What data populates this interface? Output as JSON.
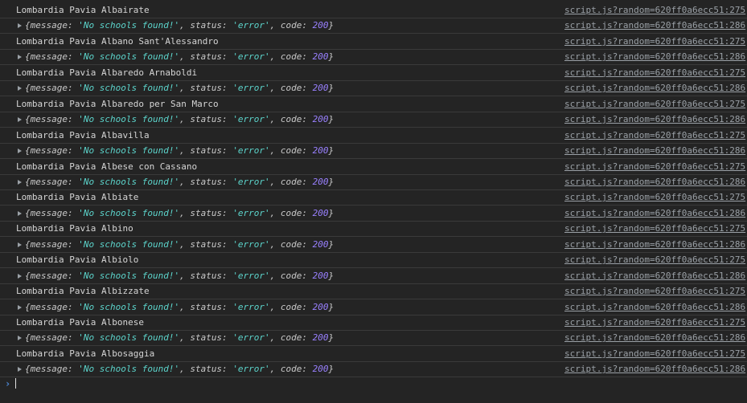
{
  "console": {
    "entries": [
      {
        "type": "text",
        "text": "Lombardia Pavia Albairate",
        "source": "script.js?random=620ff0a6ecc51:275"
      },
      {
        "type": "object",
        "message": "'No schools found!'",
        "status": "'error'",
        "code": "200",
        "source": "script.js?random=620ff0a6ecc51:286"
      },
      {
        "type": "text",
        "text": "Lombardia Pavia Albano Sant'Alessandro",
        "source": "script.js?random=620ff0a6ecc51:275"
      },
      {
        "type": "object",
        "message": "'No schools found!'",
        "status": "'error'",
        "code": "200",
        "source": "script.js?random=620ff0a6ecc51:286"
      },
      {
        "type": "text",
        "text": "Lombardia Pavia Albaredo Arnaboldi",
        "source": "script.js?random=620ff0a6ecc51:275"
      },
      {
        "type": "object",
        "message": "'No schools found!'",
        "status": "'error'",
        "code": "200",
        "source": "script.js?random=620ff0a6ecc51:286"
      },
      {
        "type": "text",
        "text": "Lombardia Pavia Albaredo per San Marco",
        "source": "script.js?random=620ff0a6ecc51:275"
      },
      {
        "type": "object",
        "message": "'No schools found!'",
        "status": "'error'",
        "code": "200",
        "source": "script.js?random=620ff0a6ecc51:286"
      },
      {
        "type": "text",
        "text": "Lombardia Pavia Albavilla",
        "source": "script.js?random=620ff0a6ecc51:275"
      },
      {
        "type": "object",
        "message": "'No schools found!'",
        "status": "'error'",
        "code": "200",
        "source": "script.js?random=620ff0a6ecc51:286"
      },
      {
        "type": "text",
        "text": "Lombardia Pavia Albese con Cassano",
        "source": "script.js?random=620ff0a6ecc51:275"
      },
      {
        "type": "object",
        "message": "'No schools found!'",
        "status": "'error'",
        "code": "200",
        "source": "script.js?random=620ff0a6ecc51:286"
      },
      {
        "type": "text",
        "text": "Lombardia Pavia Albiate",
        "source": "script.js?random=620ff0a6ecc51:275"
      },
      {
        "type": "object",
        "message": "'No schools found!'",
        "status": "'error'",
        "code": "200",
        "source": "script.js?random=620ff0a6ecc51:286"
      },
      {
        "type": "text",
        "text": "Lombardia Pavia Albino",
        "source": "script.js?random=620ff0a6ecc51:275"
      },
      {
        "type": "object",
        "message": "'No schools found!'",
        "status": "'error'",
        "code": "200",
        "source": "script.js?random=620ff0a6ecc51:286"
      },
      {
        "type": "text",
        "text": "Lombardia Pavia Albiolo",
        "source": "script.js?random=620ff0a6ecc51:275"
      },
      {
        "type": "object",
        "message": "'No schools found!'",
        "status": "'error'",
        "code": "200",
        "source": "script.js?random=620ff0a6ecc51:286"
      },
      {
        "type": "text",
        "text": "Lombardia Pavia Albizzate",
        "source": "script.js?random=620ff0a6ecc51:275"
      },
      {
        "type": "object",
        "message": "'No schools found!'",
        "status": "'error'",
        "code": "200",
        "source": "script.js?random=620ff0a6ecc51:286"
      },
      {
        "type": "text",
        "text": "Lombardia Pavia Albonese",
        "source": "script.js?random=620ff0a6ecc51:275"
      },
      {
        "type": "object",
        "message": "'No schools found!'",
        "status": "'error'",
        "code": "200",
        "source": "script.js?random=620ff0a6ecc51:286"
      },
      {
        "type": "text",
        "text": "Lombardia Pavia Albosaggia",
        "source": "script.js?random=620ff0a6ecc51:275"
      },
      {
        "type": "object",
        "message": "'No schools found!'",
        "status": "'error'",
        "code": "200",
        "source": "script.js?random=620ff0a6ecc51:286"
      }
    ],
    "object_keys": {
      "open": "{",
      "message": "message: ",
      "status": ", status: ",
      "code": ", code: ",
      "close": "}"
    },
    "prompt": {
      "chevron": "›",
      "value": ""
    },
    "colors": {
      "background": "#242424",
      "string": "#5cd5cc",
      "number": "#9980ff",
      "link": "#9aa0a6",
      "prompt": "#4e8ad8"
    }
  }
}
